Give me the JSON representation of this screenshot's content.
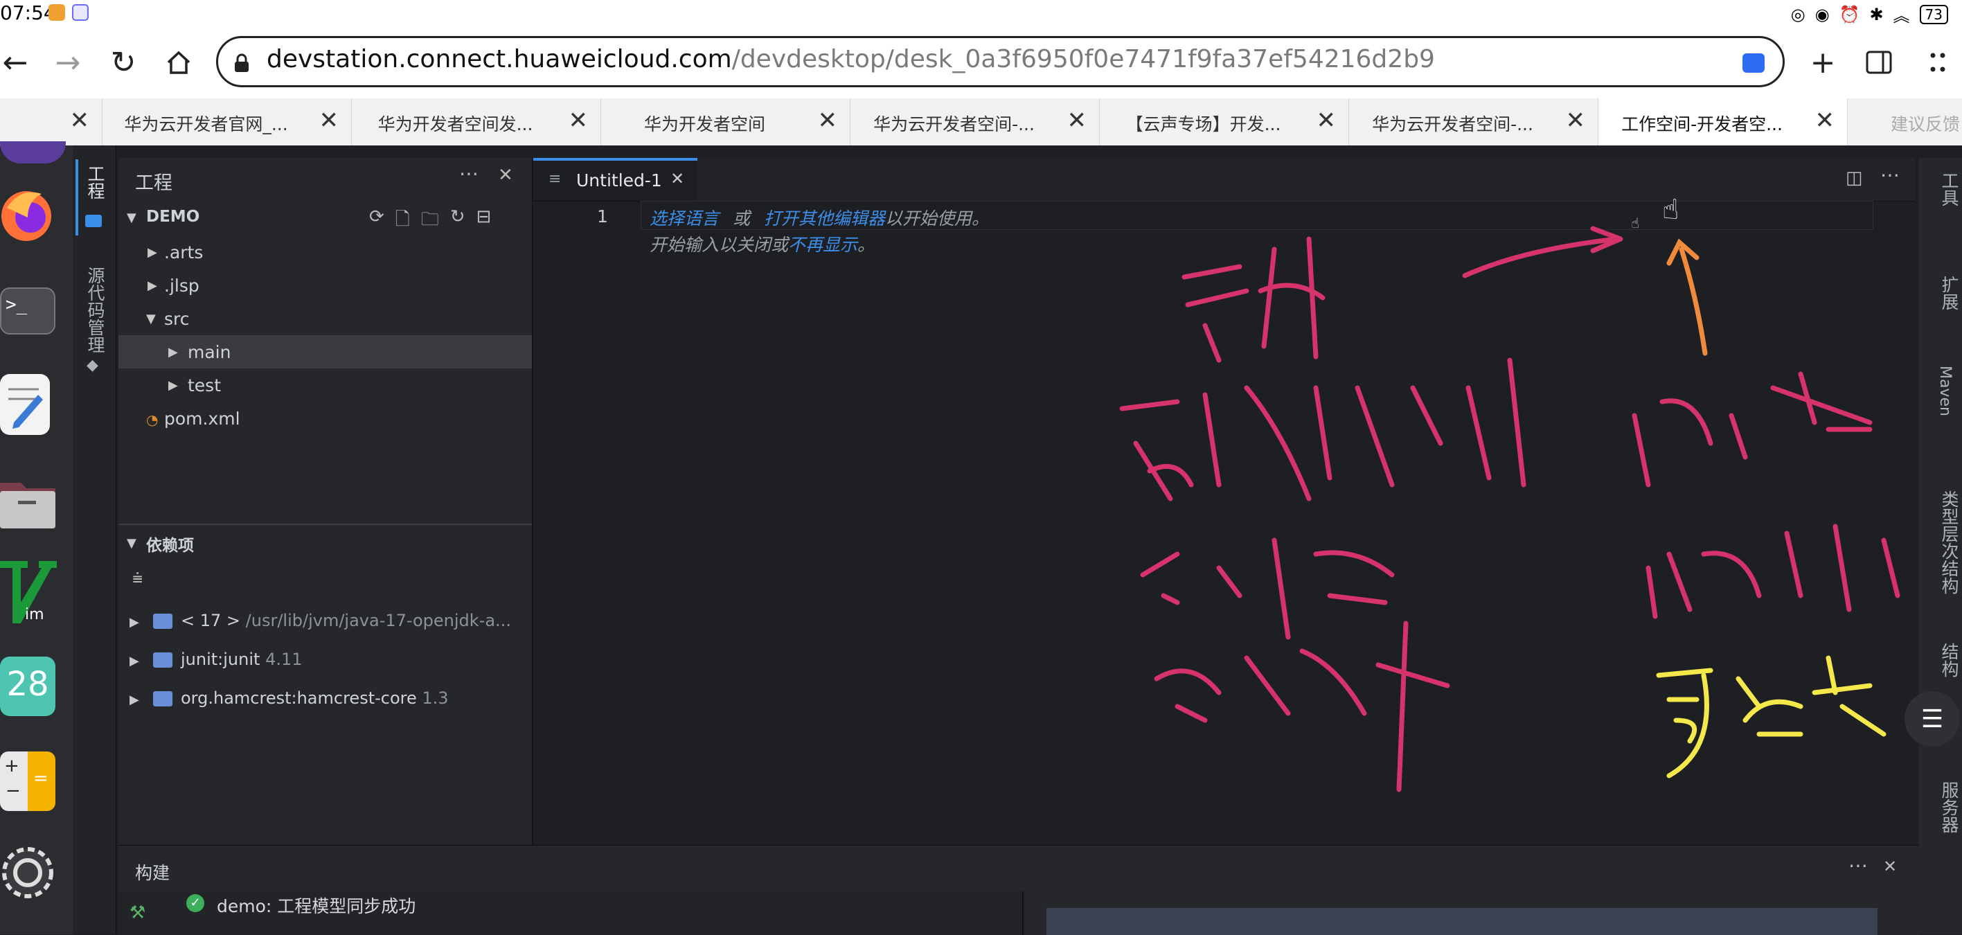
{
  "status_bar": {
    "time": "07:54",
    "battery": "73"
  },
  "browser": {
    "url_host": "devstation.connect.huaweicloud.com",
    "url_path": "/devdesktop/desk_0a3f6950f0e7471f9fa37ef54216d2b9",
    "tabs": [
      {
        "label": "华为云开发者官网_..."
      },
      {
        "label": "华为开发者空间发..."
      },
      {
        "label": "华为开发者空间"
      },
      {
        "label": "华为云开发者空间-..."
      },
      {
        "label": "【云声专场】开发..."
      },
      {
        "label": "华为云开发者空间-..."
      },
      {
        "label": "工作空间-开发者空..."
      },
      {
        "label": "建议反馈"
      }
    ]
  },
  "dock": {
    "calendar_day": "28"
  },
  "ide": {
    "activity_left": {
      "project": "工程",
      "scm": "源代码管理"
    },
    "explorer": {
      "title": "工程",
      "root": "DEMO",
      "items": [
        {
          "label": ".arts"
        },
        {
          "label": ".jlsp"
        },
        {
          "label": "src"
        },
        {
          "label": "main"
        },
        {
          "label": "test"
        },
        {
          "label": "pom.xml"
        }
      ],
      "deps_title": "依赖项",
      "deps": [
        {
          "name": "< 17 >",
          "detail": "/usr/lib/jvm/java-17-openjdk-a..."
        },
        {
          "name": "junit:junit",
          "detail": "4.11"
        },
        {
          "name": "org.hamcrest:hamcrest-core",
          "detail": "1.3"
        }
      ]
    },
    "editor": {
      "tab_label": "Untitled-1",
      "line_number": "1",
      "hint_link1": "选择语言",
      "hint_or": "或",
      "hint_link2": "打开其他编辑器",
      "hint_tail": "以开始使用。",
      "hint2_text": "开始输入以关闭或",
      "hint2_link": "不再显示",
      "hint2_end": "。"
    },
    "activity_right": {
      "tools": "工具",
      "extensions": "扩展",
      "maven": "Maven",
      "hierarchy": "类型层次结构",
      "structure": "结构",
      "services": "服务器"
    },
    "build": {
      "title": "构建",
      "status": "demo: 工程模型同步成功"
    }
  },
  "colors": {
    "accent_blue": "#3b8eea",
    "ink_pink": "#d6336c",
    "ink_orange": "#f08a3c",
    "ink_yellow": "#f5e84a"
  }
}
